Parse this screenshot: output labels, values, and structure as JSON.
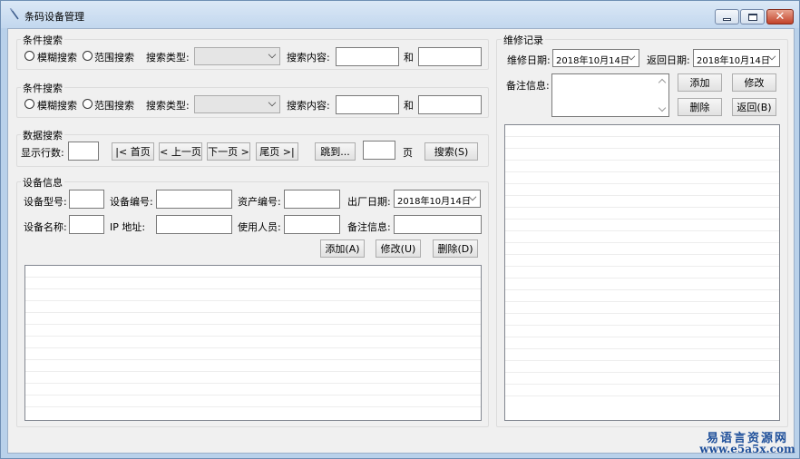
{
  "window": {
    "title": "条码设备管理"
  },
  "search1": {
    "group_title": "条件搜索",
    "radio_fuzzy": "模糊搜索",
    "radio_range": "范围搜索",
    "type_label": "搜索类型:",
    "content_label": "搜索内容:",
    "and_label": "和"
  },
  "search2": {
    "group_title": "条件搜索",
    "radio_fuzzy": "模糊搜索",
    "radio_range": "范围搜索",
    "type_label": "搜索类型:",
    "content_label": "搜索内容:",
    "and_label": "和"
  },
  "data_search": {
    "group_title": "数据搜索",
    "rows_label": "显示行数:",
    "first_button": "|< 首页",
    "prev_button": "< 上一页",
    "next_button": "下一页 >",
    "last_button": "尾页 >|",
    "goto_button": "跳到...",
    "page_label": "页",
    "search_button": "搜索(S)"
  },
  "device_info": {
    "group_title": "设备信息",
    "model_label": "设备型号:",
    "number_label": "设备编号:",
    "asset_label": "资产编号:",
    "factory_date_label": "出厂日期:",
    "factory_date_value": "2018年10月14日",
    "name_label": "设备名称:",
    "ip_label": "IP  地址:",
    "user_label": "使用人员:",
    "remark_label": "备注信息:",
    "add_button": "添加(A)",
    "modify_button": "修改(U)",
    "delete_button": "删除(D)"
  },
  "repair": {
    "group_title": "维修记录",
    "repair_date_label": "维修日期:",
    "repair_date_value": "2018年10月14日",
    "return_date_label": "返回日期:",
    "return_date_value": "2018年10月14日",
    "remark_label": "备注信息:",
    "add_button": "添加",
    "modify_button": "修改",
    "delete_button": "删除",
    "return_button": "返回(B)"
  },
  "watermark": {
    "name": "易语言资源网",
    "url": "www.e5a5x.com"
  },
  "colors": {
    "window_frame": "#b9d1ea",
    "client_bg": "#f0f0f0",
    "close_button": "#c24229",
    "watermark": "#1e4f9a"
  }
}
